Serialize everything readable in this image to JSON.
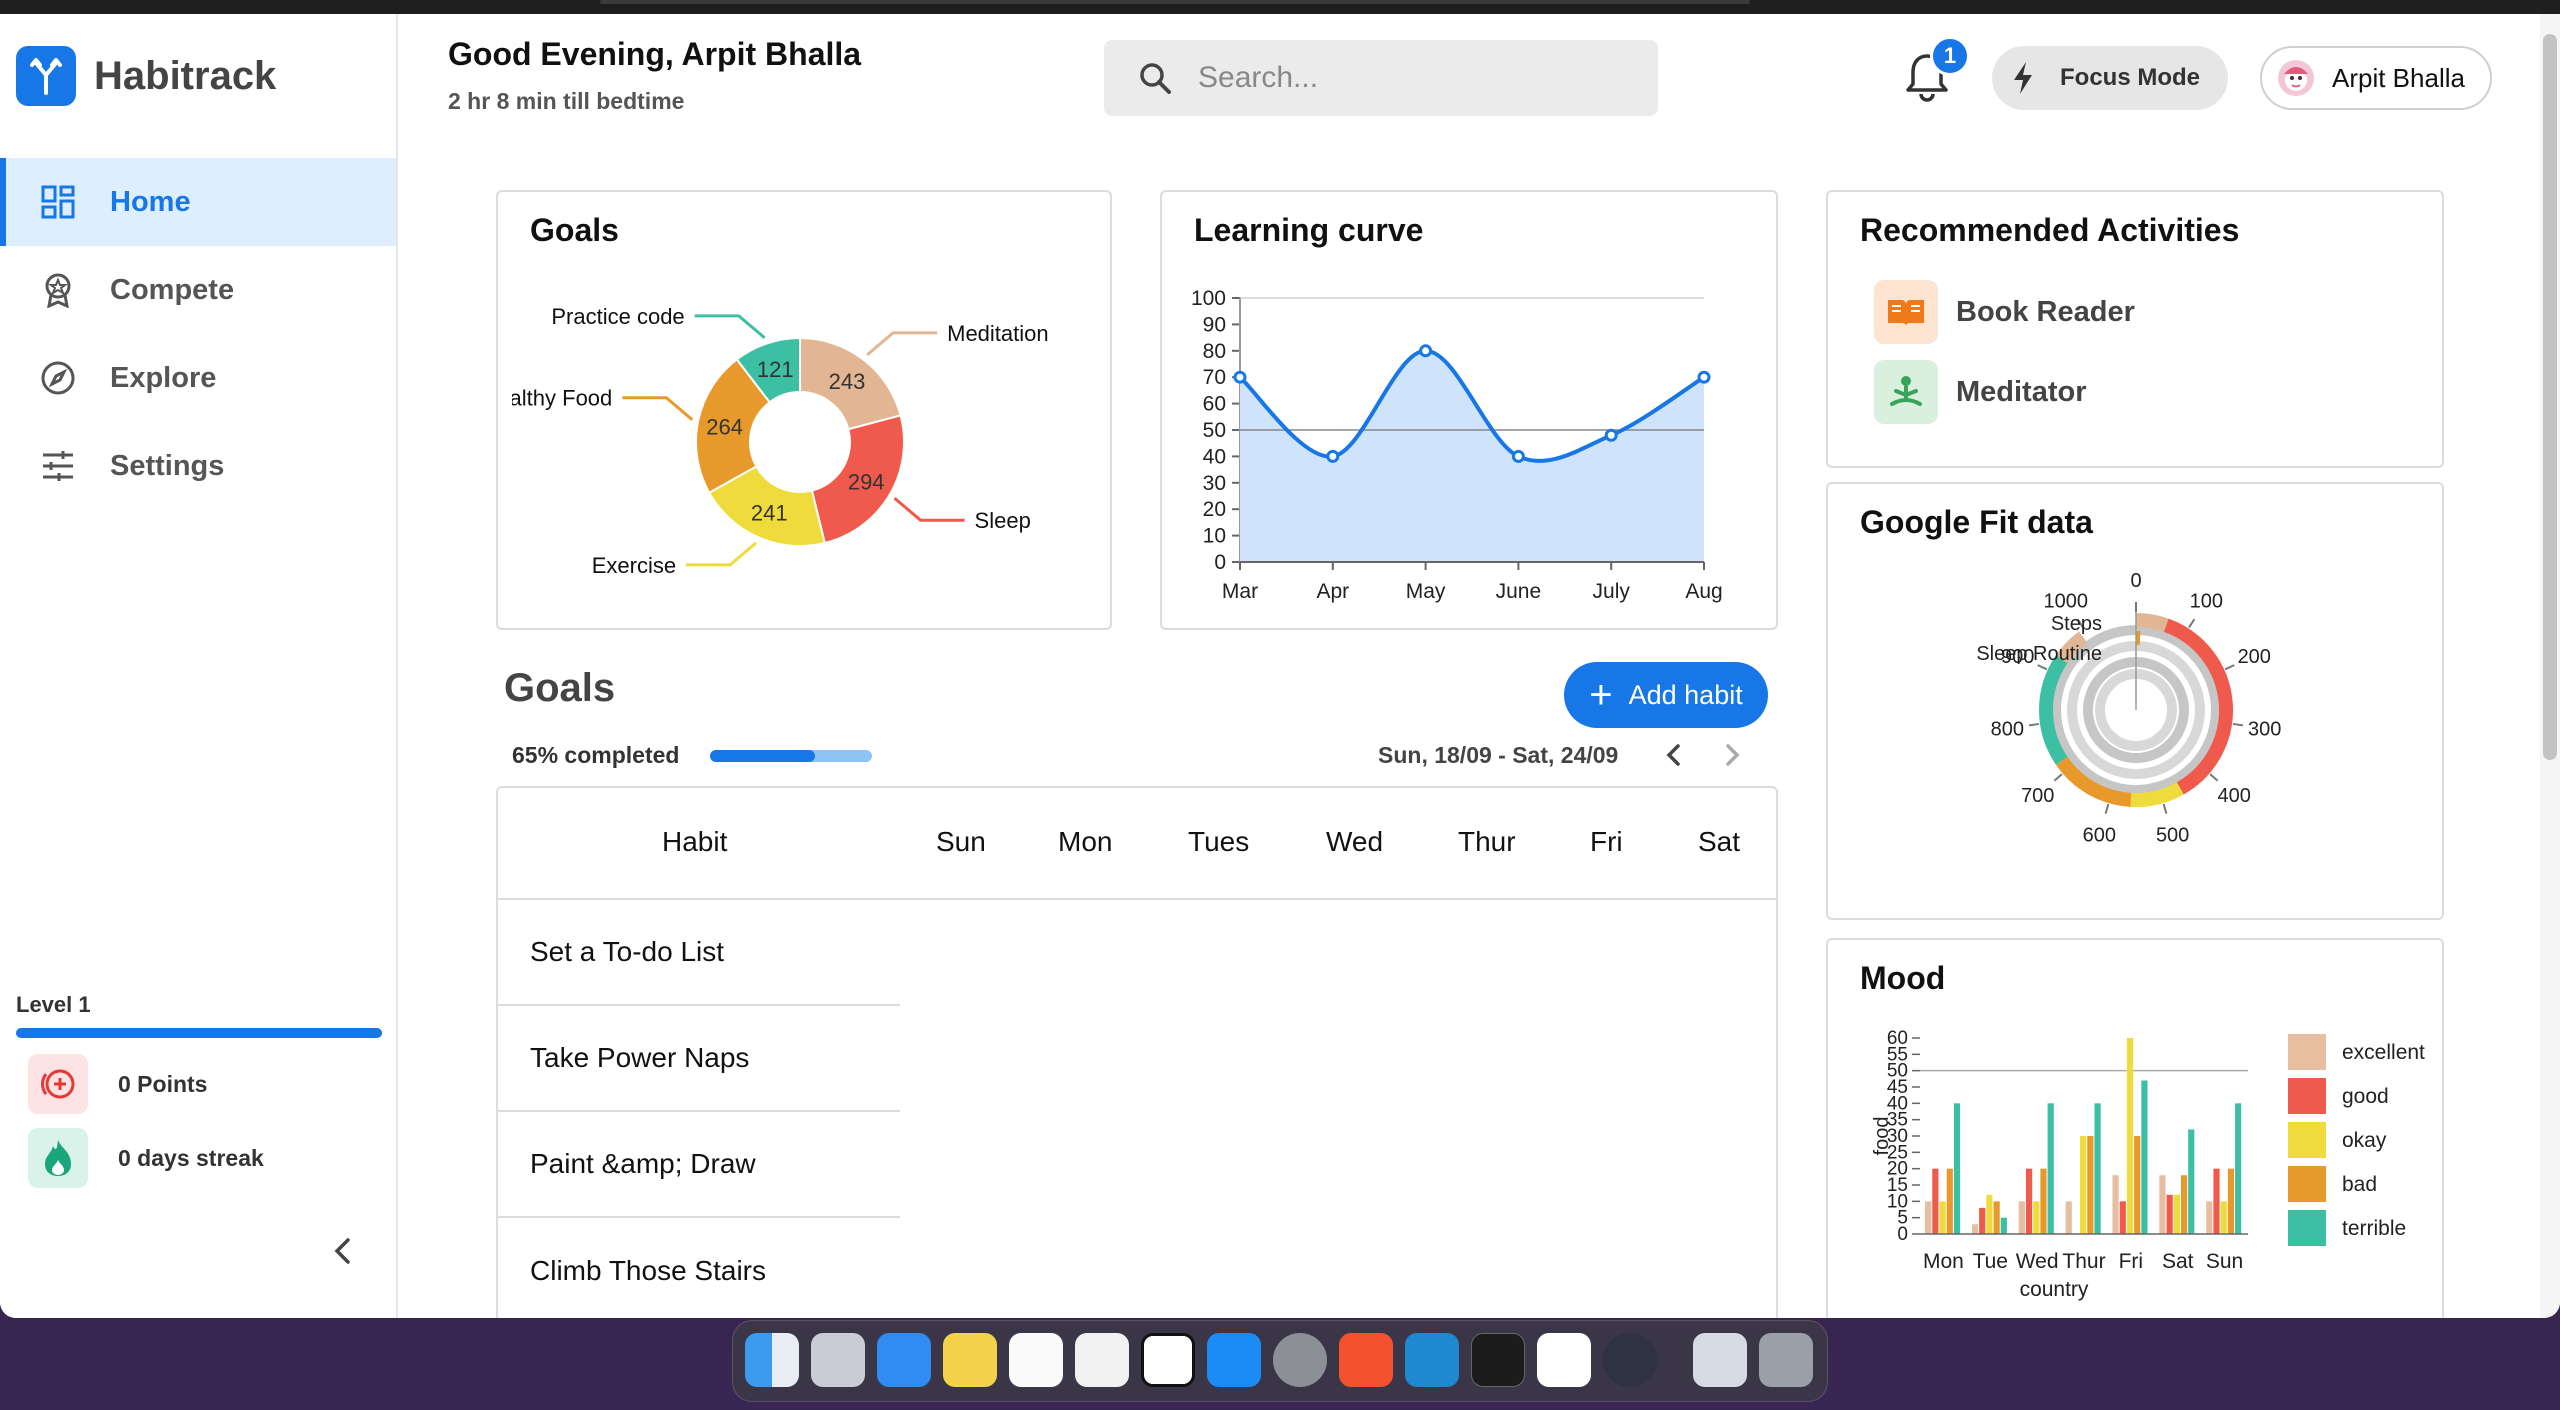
{
  "app": {
    "name": "Habitrack"
  },
  "sidebar": {
    "items": [
      {
        "label": "Home",
        "icon": "dashboard-icon",
        "active": true
      },
      {
        "label": "Compete",
        "icon": "award-icon"
      },
      {
        "label": "Explore",
        "icon": "compass-icon"
      },
      {
        "label": "Settings",
        "icon": "sliders-icon"
      }
    ],
    "level_label": "Level 1",
    "level_progress": 1.0,
    "points": "0 Points",
    "streak": "0 days streak"
  },
  "header": {
    "greeting": "Good Evening, Arpit Bhalla",
    "bedtime": "2 hr 8 min till bedtime",
    "search_placeholder": "Search...",
    "notification_count": "1",
    "focus_mode_label": "Focus Mode",
    "user_name": "Arpit Bhalla"
  },
  "goals_card": {
    "title": "Goals"
  },
  "learning_card": {
    "title": "Learning curve"
  },
  "recommended": {
    "title": "Recommended Activities",
    "items": [
      {
        "label": "Book Reader",
        "icon": "book-icon",
        "color": "#f07a1a"
      },
      {
        "label": "Meditator",
        "icon": "meditation-icon",
        "color": "#3aa35b"
      }
    ]
  },
  "google_fit": {
    "title": "Google Fit data"
  },
  "mood": {
    "title": "Mood"
  },
  "habits_section": {
    "title": "Goals",
    "add_habit_label": "Add habit",
    "completed_label": "65% completed",
    "completed_fraction": 0.65,
    "date_range": "Sun, 18/09 - Sat, 24/09",
    "columns": [
      "Habit",
      "Sun",
      "Mon",
      "Tues",
      "Wed",
      "Thur",
      "Fri",
      "Sat"
    ],
    "rows": [
      "Set a To-do List",
      "Take Power Naps",
      "Paint &amp; Draw",
      "Climb Those Stairs"
    ]
  },
  "chart_data": [
    {
      "type": "pie",
      "title": "Goals",
      "categories": [
        "Practice code",
        "Meditation",
        "Sleep",
        "Exercise",
        "Healthy Food"
      ],
      "values": [
        121,
        243,
        294,
        241,
        264
      ],
      "colors": [
        "#3dbfa4",
        "#e2b593",
        "#ef5a4c",
        "#f0db3c",
        "#e8992c"
      ]
    },
    {
      "type": "area",
      "title": "Learning curve",
      "categories": [
        "Mar",
        "Apr",
        "May",
        "June",
        "July",
        "Aug"
      ],
      "values": [
        70,
        40,
        80,
        40,
        48,
        70
      ],
      "ylim": [
        0,
        100
      ],
      "yticks": [
        0,
        10,
        20,
        30,
        40,
        50,
        60,
        70,
        80,
        90,
        100
      ],
      "reference_line": 50,
      "color": "#1877e6"
    },
    {
      "type": "radial-bar",
      "title": "Google Fit data",
      "axis_ticks": [
        0,
        100,
        200,
        300,
        400,
        500,
        600,
        700,
        800,
        900,
        1000
      ],
      "series_labels": [
        "Steps",
        "Sleep Routine"
      ],
      "ring_segments": [
        {
          "ring": "Steps",
          "from": 0,
          "to": 60,
          "color": "#e2b593"
        },
        {
          "ring": "Steps",
          "from": 60,
          "to": 460,
          "color": "#ef5a4c"
        },
        {
          "ring": "Steps",
          "from": 460,
          "to": 560,
          "color": "#f0db3c"
        },
        {
          "ring": "Steps",
          "from": 560,
          "to": 720,
          "color": "#e8992c"
        },
        {
          "ring": "Steps",
          "from": 720,
          "to": 930,
          "color": "#3dbfa4"
        },
        {
          "ring": "Steps",
          "from": 930,
          "to": 990,
          "color": "#e2b593"
        },
        {
          "ring": "Sleep Routine",
          "from": 0,
          "to": 10,
          "color": "#e8992c"
        }
      ]
    },
    {
      "type": "bar",
      "title": "Mood",
      "categories": [
        "Mon",
        "Tue",
        "Wed",
        "Thur",
        "Fri",
        "Sat",
        "Sun"
      ],
      "xlabel": "country",
      "ylabel": "food",
      "ylim": [
        0,
        60
      ],
      "yticks": [
        0,
        5,
        10,
        15,
        20,
        25,
        30,
        35,
        40,
        45,
        50,
        55,
        60
      ],
      "reference_line": 50,
      "legend_position": "right",
      "series": [
        {
          "name": "excellent",
          "color": "#e8bea0",
          "values": [
            10,
            3,
            10,
            10,
            18,
            18,
            10
          ]
        },
        {
          "name": "good",
          "color": "#ef5a4c",
          "values": [
            20,
            8,
            20,
            0,
            10,
            12,
            20
          ]
        },
        {
          "name": "okay",
          "color": "#f0db3c",
          "values": [
            10,
            12,
            10,
            30,
            60,
            12,
            10
          ]
        },
        {
          "name": "bad",
          "color": "#e8992c",
          "values": [
            20,
            10,
            20,
            30,
            30,
            18,
            20
          ]
        },
        {
          "name": "terrible",
          "color": "#3dbfa4",
          "values": [
            40,
            5,
            40,
            40,
            47,
            32,
            40
          ]
        }
      ]
    }
  ]
}
